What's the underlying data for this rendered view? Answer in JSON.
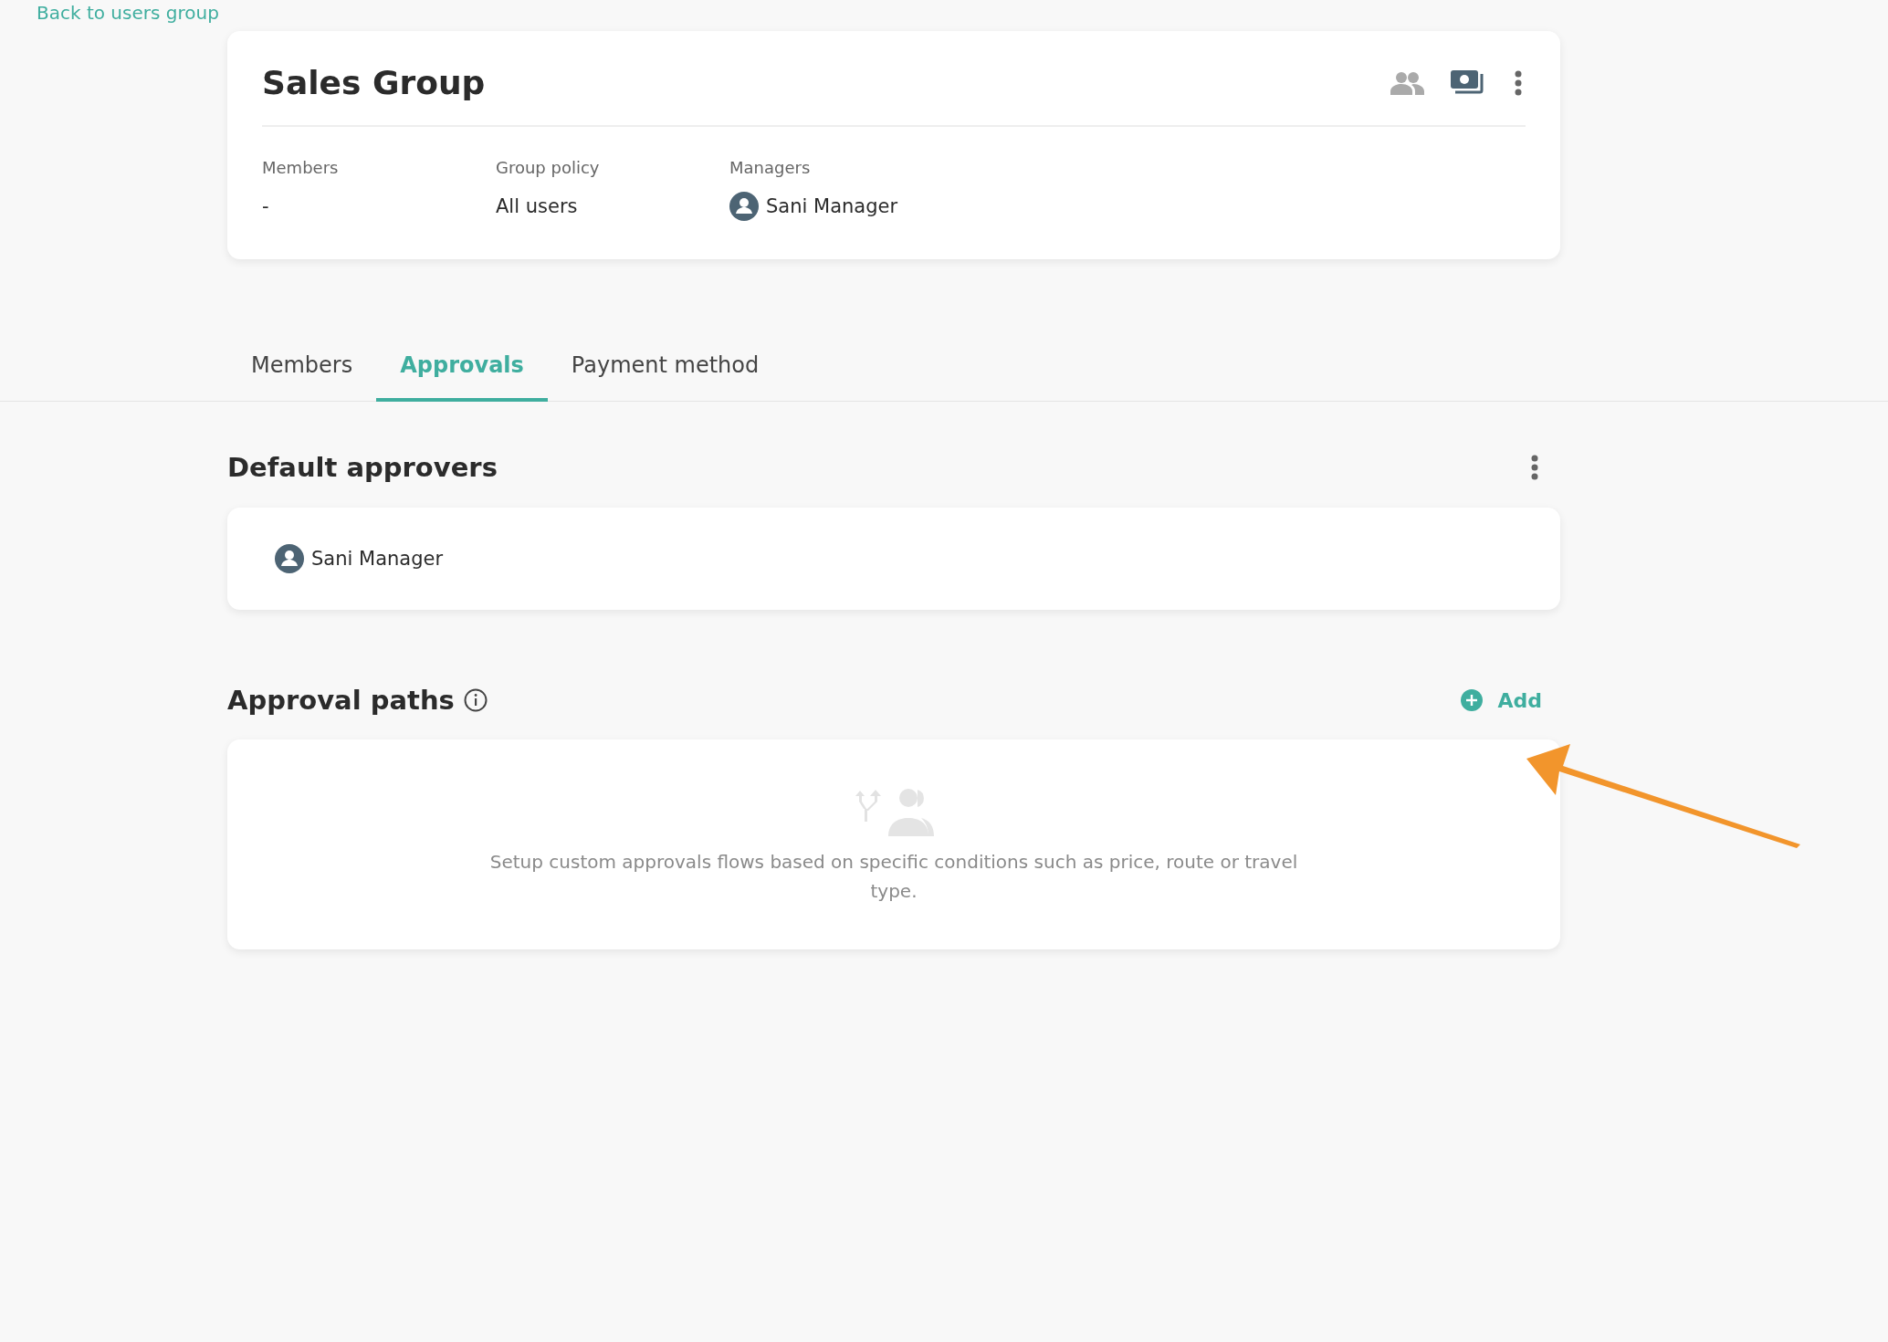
{
  "back_link": {
    "label": "Back to users group"
  },
  "group": {
    "title": "Sales Group",
    "fields": [
      {
        "kind": "text",
        "label": "Members",
        "value": "-"
      },
      {
        "kind": "text",
        "label": "Group policy",
        "value": "All users"
      },
      {
        "kind": "person",
        "label": "Managers",
        "value": "Sani Manager"
      }
    ]
  },
  "tabs": [
    {
      "label": "Members",
      "selected": false
    },
    {
      "label": "Approvals",
      "selected": true
    },
    {
      "label": "Payment method",
      "selected": false
    }
  ],
  "default_approvers": {
    "title": "Default approvers",
    "approvers": [
      "Sani Manager"
    ]
  },
  "approval_paths": {
    "title": "Approval paths",
    "add_label": "Add",
    "empty_text": "Setup custom approvals flows based on specific conditions such as price, route or travel type."
  }
}
